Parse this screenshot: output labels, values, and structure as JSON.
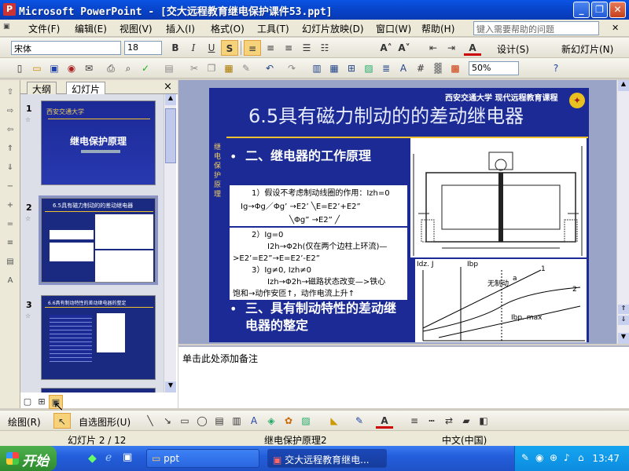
{
  "titlebar": {
    "title": "Microsoft PowerPoint - [交大远程教育继电保护课件53.ppt]",
    "minimize": "_",
    "restore": "❐",
    "close": "✕"
  },
  "menubar": {
    "items": [
      "文件(F)",
      "编辑(E)",
      "视图(V)",
      "插入(I)",
      "格式(O)",
      "工具(T)",
      "幻灯片放映(D)",
      "窗口(W)",
      "帮助(H)"
    ],
    "help_placeholder": "键入需要帮助的问题",
    "close_doc": "✕"
  },
  "toolbar1": {
    "font": "宋体",
    "size": "18",
    "bold": "B",
    "italic": "I",
    "underline": "U",
    "shadow": "S",
    "design": "设计(S)",
    "new_slide": "新幻灯片(N)"
  },
  "toolbar2": {
    "zoom": "50%"
  },
  "panel": {
    "tab_outline": "大纲",
    "tab_slides": "幻灯片",
    "close": "×",
    "slides": [
      {
        "num": "1",
        "title": "继电保护原理",
        "header": "西安交通大学"
      },
      {
        "num": "2",
        "title": "6.5具有磁力制动的的差动继电器"
      },
      {
        "num": "3",
        "title": "6.6具有制动特性的差动继电器的整定"
      }
    ]
  },
  "slide": {
    "title": "6.5具有磁力制动的的差动继电器",
    "university": "西安交通大学  现代远程教育课程",
    "side_label": "继电保护原理",
    "bullet1": "二、继电器的工作原理",
    "box1": {
      "line1": "1）假设不考虑制动线圈的作用：Izh=0",
      "line2": "Ig→Φg／Φg’ →E2’  ╲E=E2’+E2”",
      "line3": "╲Φg” →E2”  ╱"
    },
    "box2": {
      "line1": "2）Ig=0",
      "line2": "I2h→Φ2h(仅在两个边柱上环流)—",
      "line3": ">E2’=E2”→E=E2’-E2”",
      "line4": "3）Ig≠0, Izh≠0",
      "line5": "Izh→Φ2h→磁路状态改变—>铁心",
      "line6": "饱和→动作安匝↑，动作电流上升↑"
    },
    "bullet2": "三、具有制动特性的差动继电器的整定",
    "chart": {
      "ylabel": "Idz. J",
      "ylabel2": "Ibp",
      "curve_label": "无制动",
      "label_a": "a",
      "label_1": "1",
      "label_2": "2",
      "label_ibpmax": "Ibp. max"
    }
  },
  "notes": {
    "placeholder": "单击此处添加备注"
  },
  "drawbar": {
    "draw": "绘图(R)",
    "autoshapes": "自选图形(U)"
  },
  "statusbar": {
    "slide": "幻灯片 2 / 12",
    "design": "继电保护原理2",
    "language": "中文(中国)"
  },
  "taskbar": {
    "start": "开始",
    "task1": "ppt",
    "task2": "交大远程教育继电...",
    "clock": "13:47"
  }
}
